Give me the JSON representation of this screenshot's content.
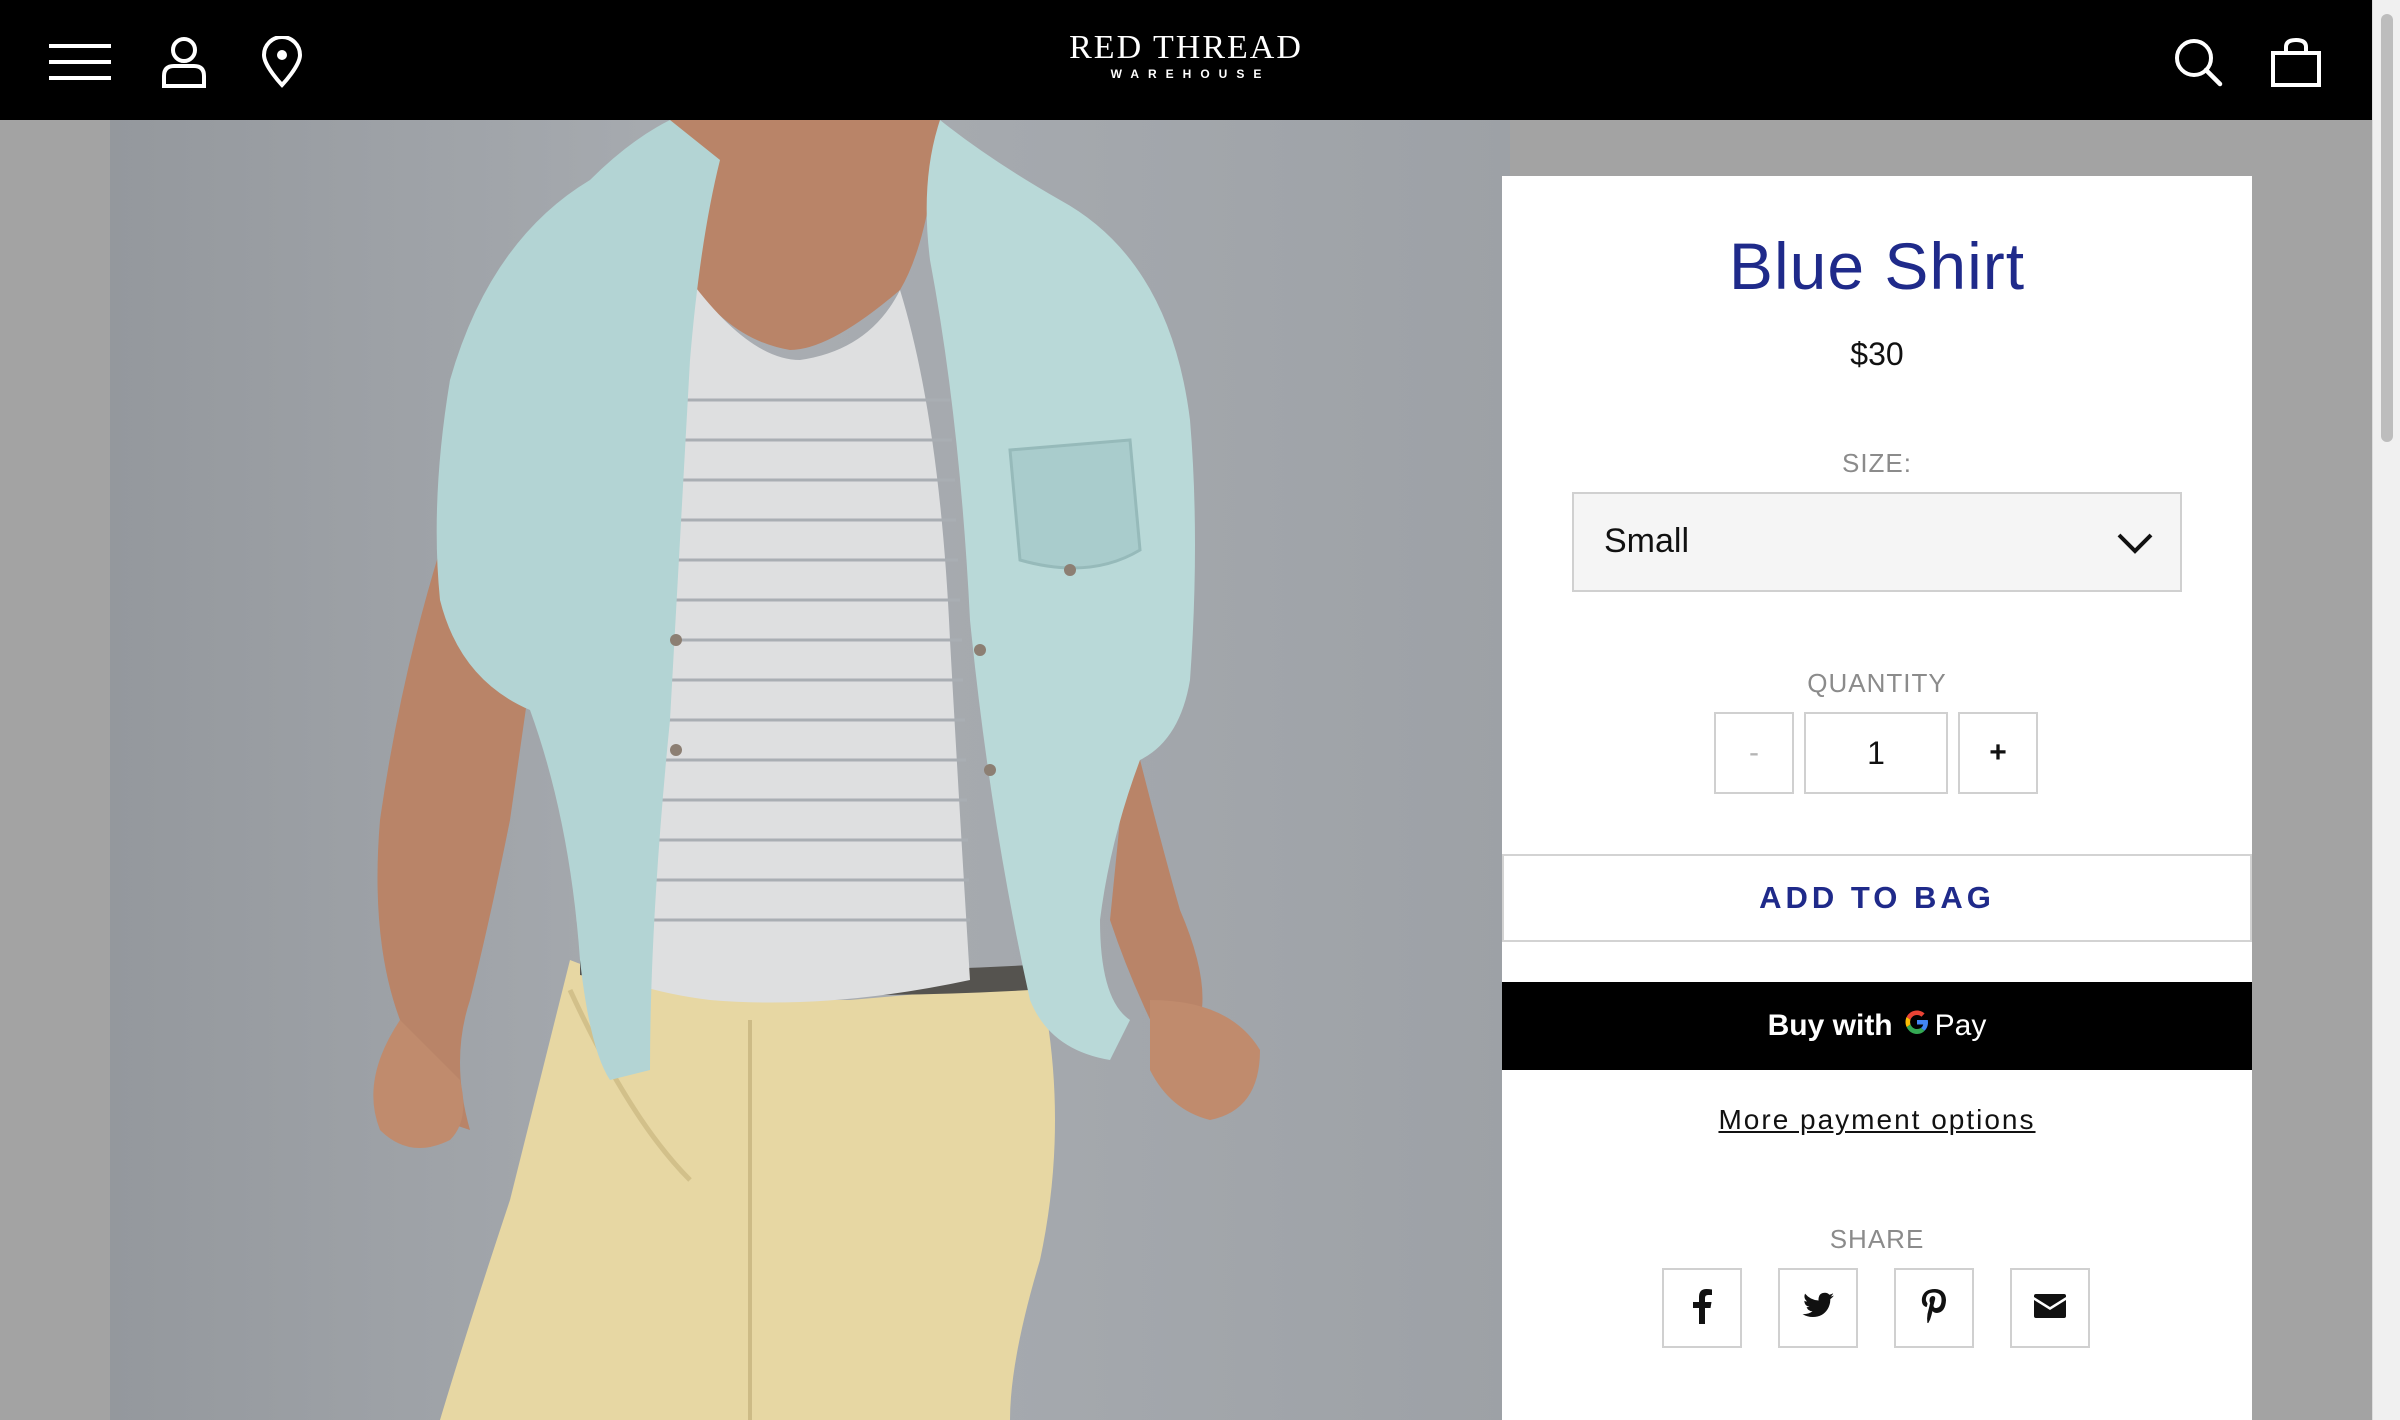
{
  "header": {
    "logo_main": "RED THREAD",
    "logo_sub": "WAREHOUSE",
    "icons": [
      "menu-icon",
      "account-icon",
      "location-icon",
      "search-icon",
      "bag-icon"
    ]
  },
  "product": {
    "title": "Blue Shirt",
    "price": "$30",
    "size_label": "SIZE:",
    "size_value": "Small",
    "quantity_label": "QUANTITY",
    "quantity_minus": "-",
    "quantity_value": "1",
    "quantity_plus": "+",
    "add_to_bag": "ADD TO BAG",
    "gpay_buy": "Buy with",
    "gpay_pay": "Pay",
    "more_payment": "More payment options",
    "share_label": "SHARE",
    "share_icons": [
      "facebook-icon",
      "twitter-icon",
      "pinterest-icon",
      "email-icon"
    ]
  },
  "colors": {
    "accent": "#1f2a8a",
    "header_bg": "#000000",
    "gpay_bg": "#000000"
  }
}
